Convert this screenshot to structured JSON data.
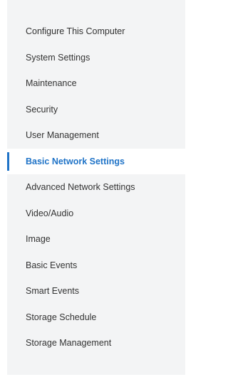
{
  "menu": {
    "items": [
      {
        "label": "Configure This Computer"
      },
      {
        "label": "System Settings"
      },
      {
        "label": "Maintenance"
      },
      {
        "label": "Security"
      },
      {
        "label": "User Management"
      },
      {
        "label": "Basic Network Settings",
        "active": true
      },
      {
        "label": "Advanced Network Settings"
      },
      {
        "label": "Video/Audio"
      },
      {
        "label": "Image"
      },
      {
        "label": "Basic Events"
      },
      {
        "label": "Smart Events"
      },
      {
        "label": "Storage Schedule"
      },
      {
        "label": "Storage Management"
      }
    ]
  },
  "colors": {
    "panel_bg": "#f3f4f5",
    "text": "#333333",
    "active_text": "#1f73c7",
    "active_indicator": "#1f73c7"
  }
}
